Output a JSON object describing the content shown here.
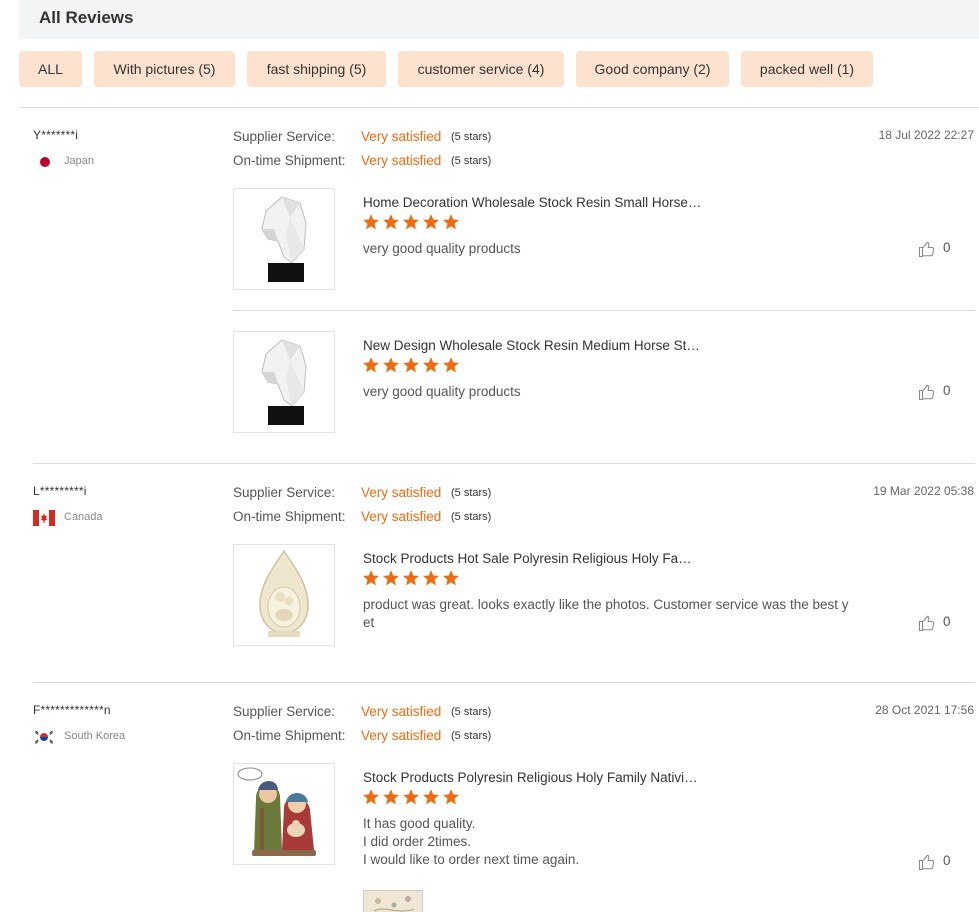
{
  "header": {
    "title": "All Reviews"
  },
  "filters": [
    {
      "label": "ALL"
    },
    {
      "label": "With pictures (5)"
    },
    {
      "label": "fast shipping (5)"
    },
    {
      "label": "customer service (4)"
    },
    {
      "label": "Good company (2)"
    },
    {
      "label": "packed well (1)"
    }
  ],
  "colors": {
    "accent": "#f06a0f",
    "chip_bg": "#fde2cf",
    "header_bg": "#f3f4f6"
  },
  "reviews": [
    {
      "user": "Y*******i",
      "country": "Japan",
      "flag_icon": "japan-flag-icon",
      "supplier_label": "Supplier Service:",
      "supplier_value": "Very satisfied",
      "supplier_stars": "(5 stars)",
      "shipment_label": "On-time Shipment:",
      "shipment_value": "Very satisfied",
      "shipment_stars": "(5 stars)",
      "date": "18 Jul 2022 22:27",
      "products": [
        {
          "title": "Home Decoration Wholesale Stock Resin Small Horse…",
          "rating": 5,
          "comment": [
            "very good quality products"
          ],
          "likes": "0",
          "image_icon": "horse-head-sculpture-image"
        },
        {
          "title": "New Design Wholesale Stock Resin Medium Horse St…",
          "rating": 5,
          "comment": [
            "very good quality products"
          ],
          "likes": "0",
          "image_icon": "horse-head-sculpture-image"
        }
      ]
    },
    {
      "user": "L*********i",
      "country": "Canada",
      "flag_icon": "canada-flag-icon",
      "supplier_label": "Supplier Service:",
      "supplier_value": "Very satisfied",
      "supplier_stars": "(5 stars)",
      "shipment_label": "On-time Shipment:",
      "shipment_value": "Very satisfied",
      "shipment_stars": "(5 stars)",
      "date": "19 Mar 2022 05:38",
      "products": [
        {
          "title": "Stock Products Hot Sale Polyresin Religious Holy Fa…",
          "rating": 5,
          "comment": [
            "product was great. looks exactly like the photos. Customer service was the best y",
            "et"
          ],
          "likes": "0",
          "image_icon": "holy-family-statue-image"
        }
      ]
    },
    {
      "user": "F*************n",
      "country": "South Korea",
      "flag_icon": "south-korea-flag-icon",
      "supplier_label": "Supplier Service:",
      "supplier_value": "Very satisfied",
      "supplier_stars": "(5 stars)",
      "shipment_label": "On-time Shipment:",
      "shipment_value": "Very satisfied",
      "shipment_stars": "(5 stars)",
      "date": "28 Oct 2021 17:56",
      "products": [
        {
          "title": "Stock Products Polyresin Religious Holy Family Nativi…",
          "rating": 5,
          "comment": [
            "It has good quality.",
            "I did order 2times.",
            "I would like to order next time again."
          ],
          "likes": "0",
          "image_icon": "nativity-figurine-image"
        }
      ]
    }
  ]
}
